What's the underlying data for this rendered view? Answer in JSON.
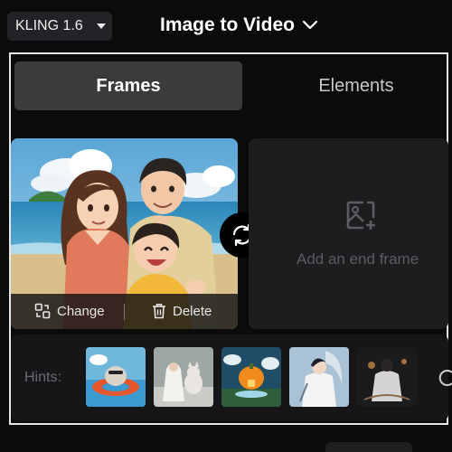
{
  "header": {
    "model_label": "KLING 1.6",
    "title": "Image to Video"
  },
  "tabs": [
    {
      "label": "Frames",
      "active": true
    },
    {
      "label": "Elements",
      "active": false
    }
  ],
  "start_frame": {
    "change_label": "Change",
    "delete_label": "Delete"
  },
  "end_frame": {
    "placeholder": "Add an end frame"
  },
  "hints": {
    "label": "Hints:",
    "thumbnails": [
      "otter-float-thumbnail",
      "bride-cat-thumbnail",
      "pumpkin-house-thumbnail",
      "white-robed-swordsman-thumbnail",
      "dark-warrior-thumbnail"
    ]
  },
  "colors": {
    "active_tab": "#3b3b3d",
    "panel_border": "#e6e6e6",
    "placeholder_text": "#5c5d61"
  }
}
